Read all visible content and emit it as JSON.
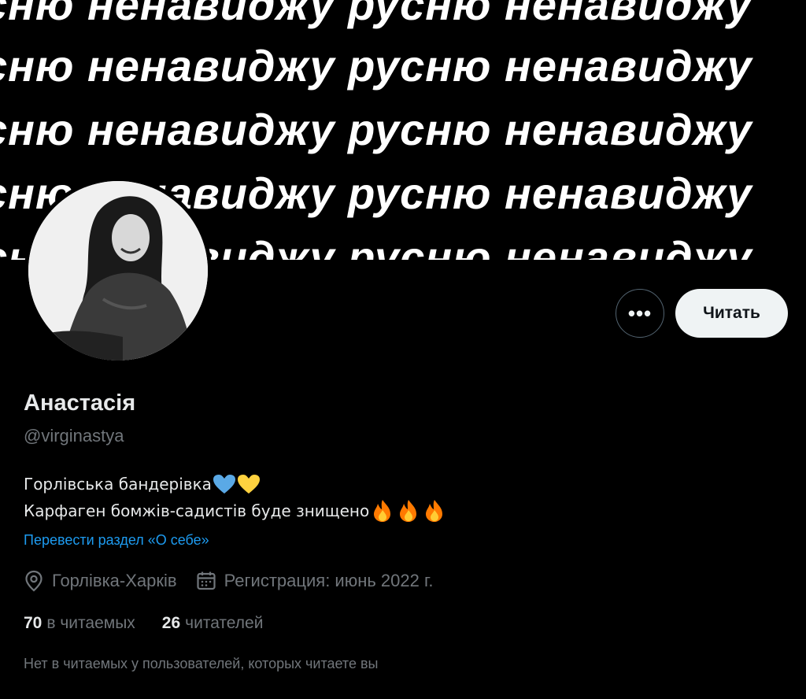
{
  "banner": {
    "lines": [
      "сню ненавиджу русню ненавиджу",
      "сню ненавиджу русню ненавиджу",
      "сню ненавиджу русню ненавиджу",
      "сню ненавиджу русню ненавиджу",
      "сню ненавиджу русню ненавиджу"
    ]
  },
  "actions": {
    "more_label": "•••",
    "follow_label": "Читать"
  },
  "profile": {
    "name": "Анастасія",
    "handle": "@virginastya",
    "bio_line1": "Горлівська бандерівка",
    "bio_line2": "Карфаген бомжів-садистів буде знищено",
    "translate_link": "Перевести раздел «О себе»",
    "location": "Горлівка-Харків",
    "joined": "Регистрация: июнь 2022 г.",
    "following_count": "70",
    "following_label": "в читаемых",
    "followers_count": "26",
    "followers_label": "читателей",
    "followers_you_know": "Нет в читаемых у пользователей, которых читаете вы"
  },
  "colors": {
    "accent": "#1d9bf0",
    "secondary_text": "#71767b",
    "heart_blue": "#5aa9e6",
    "heart_yellow": "#ffd23f",
    "fire": "#ff7a00"
  },
  "icons": {
    "heart_blue": "blue-heart-icon",
    "heart_yellow": "yellow-heart-icon",
    "fire": "fire-icon",
    "location": "location-pin-icon",
    "calendar": "calendar-icon"
  }
}
